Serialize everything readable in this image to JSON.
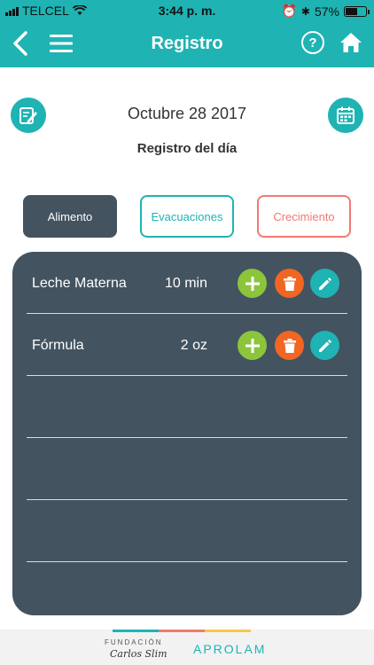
{
  "status_bar": {
    "carrier": "TELCEL",
    "time": "3:44 p. m.",
    "battery": "57%"
  },
  "nav": {
    "title": "Registro",
    "help_label": "?"
  },
  "date_section": {
    "date": "Octubre 28 2017",
    "subtitle": "Registro del día"
  },
  "tabs": [
    {
      "label": "Alimento",
      "active": true
    },
    {
      "label": "Evacuaciones",
      "active": false
    },
    {
      "label": "Crecimiento",
      "active": false
    }
  ],
  "entries": [
    {
      "name": "Leche Materna",
      "amount": "10 min"
    },
    {
      "name": "Fórmula",
      "amount": "2 oz"
    }
  ],
  "footer": {
    "org": "FUNDACIÓN",
    "brand": "Carlos Slim",
    "logo": "APROLAM"
  },
  "colors": {
    "teal": "#1fb3b3",
    "slate": "#435360",
    "green": "#8cc43c",
    "orange": "#f26522",
    "coral": "#f07a72",
    "yellow": "#f3c84c"
  }
}
